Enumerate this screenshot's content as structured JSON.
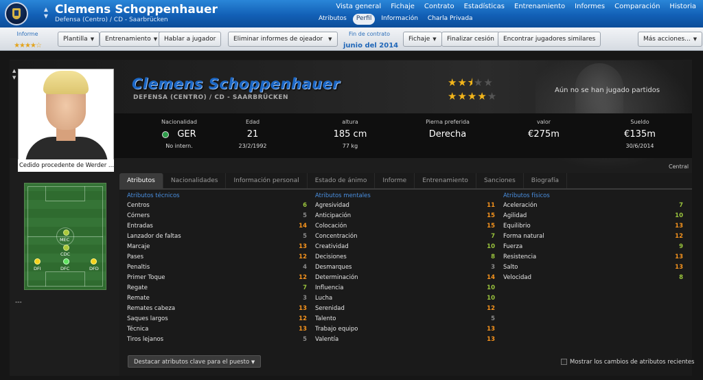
{
  "header": {
    "player_name": "Clemens Schoppenhauer",
    "player_sub": "Defensa (Centro) / CD - Saarbrücken",
    "nav": [
      "Vista general",
      "Fichaje",
      "Contrato",
      "Estadísticas",
      "Entrenamiento",
      "Informes",
      "Comparación",
      "Historia"
    ],
    "subtabs": [
      "Atributos",
      "Perfil",
      "Información",
      "Charla Privada"
    ],
    "active_subtab": "Perfil"
  },
  "toolbar": {
    "informe_label": "Informe",
    "informe_stars": "★★★★☆",
    "plantilla": "Plantilla",
    "entrenamiento": "Entrenamiento",
    "hablar": "Hablar a jugador",
    "eliminar": "Eliminar informes de ojeador",
    "contract_label": "Fin de contrato",
    "contract_date": "junio del 2014",
    "fichaje": "Fichaje",
    "finalizar": "Finalizar cesión",
    "similares": "Encontrar jugadores similares",
    "mas": "Más acciones..."
  },
  "profile": {
    "name": "Clemens Schoppenhauer",
    "position": "DEFENSA (CENTRO) / CD - SAARBRÜCKEN",
    "caption": "Cedido procedente de Werder ...",
    "current_ability_stars": 2.5,
    "potential_ability_stars": 4,
    "no_matches": "Aún no se han jugado partidos",
    "role_label": "Central"
  },
  "info": {
    "nationality": {
      "label": "Nacionalidad",
      "value": "GER",
      "sub": "No intern."
    },
    "age": {
      "label": "Edad",
      "value": "21",
      "sub": "23/2/1992"
    },
    "height": {
      "label": "altura",
      "value": "185 cm",
      "sub": "77 kg"
    },
    "foot": {
      "label": "Pierna preferida",
      "value": "Derecha",
      "sub": ""
    },
    "value": {
      "label": "valor",
      "value": "€275m",
      "sub": ""
    },
    "wage": {
      "label": "Sueldo",
      "value": "€135m",
      "sub": "30/6/2014"
    }
  },
  "pitch": {
    "labels": {
      "mec": "MEC",
      "cdc": "CDC",
      "dfi": "DFI",
      "dfc": "DFC",
      "dfd": "DFD"
    },
    "dash": "---"
  },
  "tabs": [
    "Atributos",
    "Nacionalidades",
    "Información personal",
    "Estado de ánimo",
    "Informe",
    "Entrenamiento",
    "Sanciones",
    "Biografía"
  ],
  "attributes": {
    "technical": {
      "title": "Atributos técnicos",
      "items": [
        {
          "name": "Centros",
          "value": "6"
        },
        {
          "name": "Córners",
          "value": "5"
        },
        {
          "name": "Entradas",
          "value": "14"
        },
        {
          "name": "Lanzador de faltas",
          "value": "5"
        },
        {
          "name": "Marcaje",
          "value": "13"
        },
        {
          "name": "Pases",
          "value": "12"
        },
        {
          "name": "Penaltis",
          "value": "4"
        },
        {
          "name": "Primer Toque",
          "value": "12"
        },
        {
          "name": "Regate",
          "value": "7"
        },
        {
          "name": "Remate",
          "value": "3"
        },
        {
          "name": "Remates cabeza",
          "value": "13"
        },
        {
          "name": "Saques largos",
          "value": "12"
        },
        {
          "name": "Técnica",
          "value": "13"
        },
        {
          "name": "Tiros lejanos",
          "value": "5"
        }
      ]
    },
    "mental": {
      "title": "Atributos mentales",
      "items": [
        {
          "name": "Agresividad",
          "value": "11"
        },
        {
          "name": "Anticipación",
          "value": "15"
        },
        {
          "name": "Colocación",
          "value": "15"
        },
        {
          "name": "Concentración",
          "value": "7"
        },
        {
          "name": "Creatividad",
          "value": "10"
        },
        {
          "name": "Decisiones",
          "value": "8"
        },
        {
          "name": "Desmarques",
          "value": "3"
        },
        {
          "name": "Determinación",
          "value": "14"
        },
        {
          "name": "Influencia",
          "value": "10"
        },
        {
          "name": "Lucha",
          "value": "10"
        },
        {
          "name": "Serenidad",
          "value": "12"
        },
        {
          "name": "Talento",
          "value": "5"
        },
        {
          "name": "Trabajo equipo",
          "value": "13"
        },
        {
          "name": "Valentía",
          "value": "13"
        }
      ]
    },
    "physical": {
      "title": "Atributos físicos",
      "items": [
        {
          "name": "Aceleración",
          "value": "7"
        },
        {
          "name": "Agilidad",
          "value": "10"
        },
        {
          "name": "Equilibrio",
          "value": "13"
        },
        {
          "name": "Forma natural",
          "value": "12"
        },
        {
          "name": "Fuerza",
          "value": "9"
        },
        {
          "name": "Resistencia",
          "value": "13"
        },
        {
          "name": "Salto",
          "value": "13"
        },
        {
          "name": "Velocidad",
          "value": "8"
        }
      ]
    }
  },
  "footer": {
    "highlight_button": "Destacar atributos clave para el puesto",
    "show_changes": "Mostrar los cambios de atributos recientes"
  },
  "colors": {
    "attr_high": "#f7941d",
    "attr_mid": "#9bc53d",
    "attr_low": "#8a8a8a",
    "accent_blue": "#1b66c4",
    "star": "#f2b51a"
  }
}
